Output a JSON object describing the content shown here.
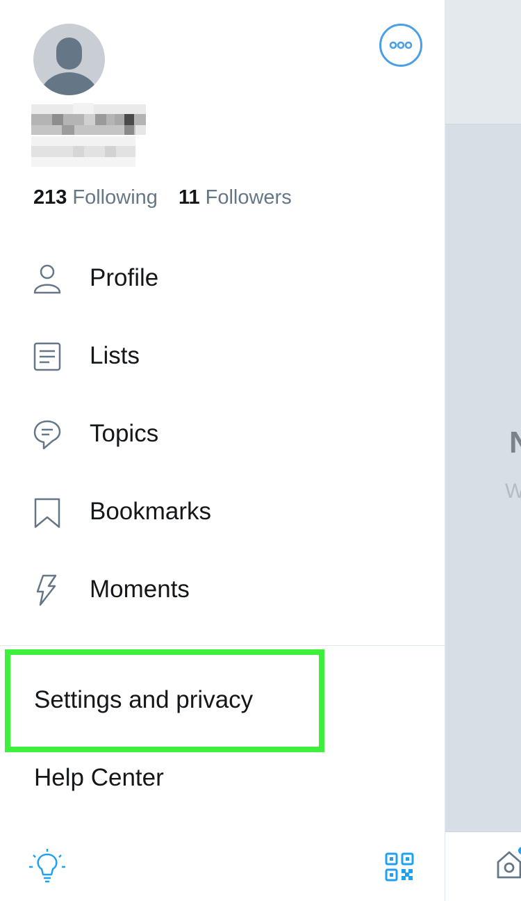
{
  "profile": {
    "following_count": "213",
    "following_label": "Following",
    "followers_count": "11",
    "followers_label": "Followers"
  },
  "menu": {
    "items": [
      {
        "label": "Profile",
        "icon": "person-icon"
      },
      {
        "label": "Lists",
        "icon": "list-icon"
      },
      {
        "label": "Topics",
        "icon": "topics-icon"
      },
      {
        "label": "Bookmarks",
        "icon": "bookmark-icon"
      },
      {
        "label": "Moments",
        "icon": "lightning-icon"
      }
    ]
  },
  "secondary": {
    "settings_label": "Settings and privacy",
    "help_label": "Help Center"
  },
  "background_view": {
    "glyph_1": "N",
    "glyph_2": "W"
  },
  "colors": {
    "accent": "#1da1f2",
    "highlight_border": "#3cf03c",
    "secondary_text": "#657786"
  }
}
